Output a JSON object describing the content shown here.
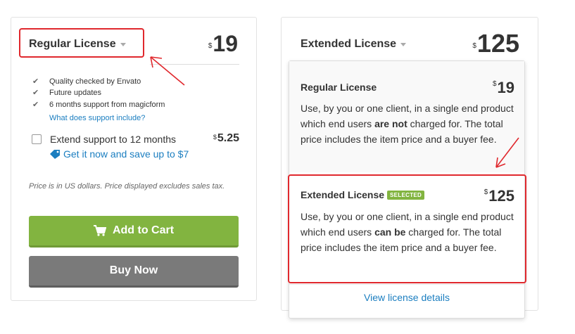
{
  "left_card": {
    "license_label": "Regular License",
    "price_currency": "$",
    "price_value": "19",
    "features": [
      "Quality checked by Envato",
      "Future updates",
      "6 months support from magicform"
    ],
    "support_link": "What does support include?",
    "extend_label": "Extend support to 12 months",
    "extend_price_currency": "$",
    "extend_price_value": "5.25",
    "extend_offer": "Get it now and save up to $7",
    "note": "Price is in US dollars. Price displayed excludes sales tax.",
    "add_to_cart": "Add to Cart",
    "buy_now": "Buy Now"
  },
  "right_card": {
    "license_label": "Extended License",
    "price_currency": "$",
    "price_value": "125"
  },
  "dropdown": {
    "regular": {
      "title": "Regular License",
      "price_currency": "$",
      "price_value": "19",
      "desc_1": "Use, by you or one client, in a single end product which end users ",
      "desc_bold": "are not",
      "desc_2": " charged for. The total price includes the item price and a buyer fee."
    },
    "extended": {
      "title": "Extended License",
      "badge": "SELECTED",
      "price_currency": "$",
      "price_value": "125",
      "desc_1": "Use, by you or one client, in a single end product which end users ",
      "desc_bold": "can be",
      "desc_2": " charged for. The total price includes the item price and a buyer fee."
    },
    "view_details": "View license details"
  },
  "colors": {
    "green": "#82b440",
    "gray_button": "#7a7a7a",
    "link": "#1b7ec0",
    "annotation_red": "#e0282d"
  },
  "icons": [
    "check-icon",
    "tag-icon",
    "cart-icon",
    "chevron-down-icon",
    "annotation-arrow-icon"
  ]
}
